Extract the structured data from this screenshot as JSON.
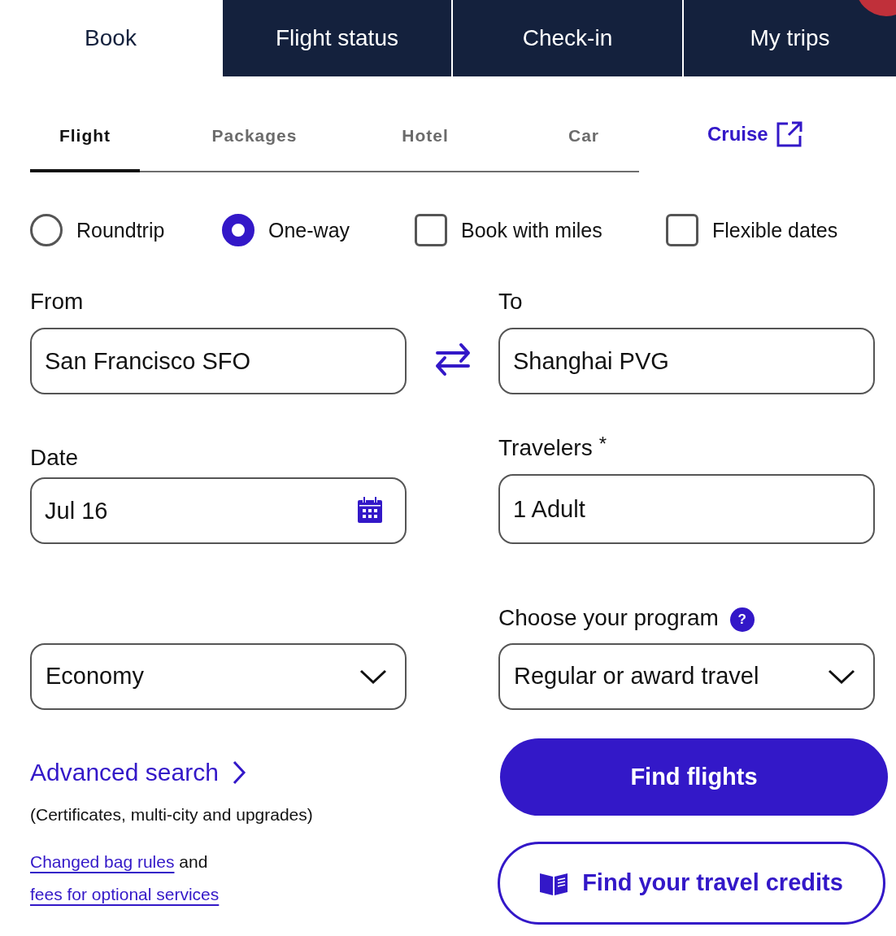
{
  "main_tabs": [
    {
      "label": "Book",
      "selected": true
    },
    {
      "label": "Flight status",
      "selected": false
    },
    {
      "label": "Check-in",
      "selected": false
    },
    {
      "label": "My trips",
      "selected": false
    }
  ],
  "product_tabs": [
    {
      "label": "Flight",
      "selected": true
    },
    {
      "label": "Packages",
      "selected": false
    },
    {
      "label": "Hotel",
      "selected": false
    },
    {
      "label": "Car",
      "selected": false
    }
  ],
  "cruise_link": {
    "label": "Cruise"
  },
  "trip_options": [
    {
      "kind": "radio",
      "label": "Roundtrip",
      "selected": false
    },
    {
      "kind": "radio",
      "label": "One-way",
      "selected": true
    },
    {
      "kind": "checkbox",
      "label": "Book with miles",
      "checked": false
    },
    {
      "kind": "checkbox",
      "label": "Flexible dates",
      "checked": false
    }
  ],
  "from": {
    "label": "From",
    "value": "San Francisco SFO"
  },
  "to": {
    "label": "To",
    "value": "Shanghai PVG"
  },
  "date": {
    "label": "Date",
    "value": "Jul 16"
  },
  "travelers": {
    "label": "Travelers",
    "required_mark": "*",
    "value": "1 Adult"
  },
  "cabin": {
    "value": "Economy"
  },
  "program": {
    "label": "Choose your program",
    "help": "?",
    "value": "Regular or award travel"
  },
  "advanced_search": {
    "label": "Advanced search",
    "note": "(Certificates, multi-city and upgrades)"
  },
  "bag_notice": {
    "link": "Changed bag rules",
    "text": "and",
    "second_link": "fees for optional services"
  },
  "buttons": {
    "find_flights": "Find flights",
    "travel_credits": "Find your travel credits"
  }
}
